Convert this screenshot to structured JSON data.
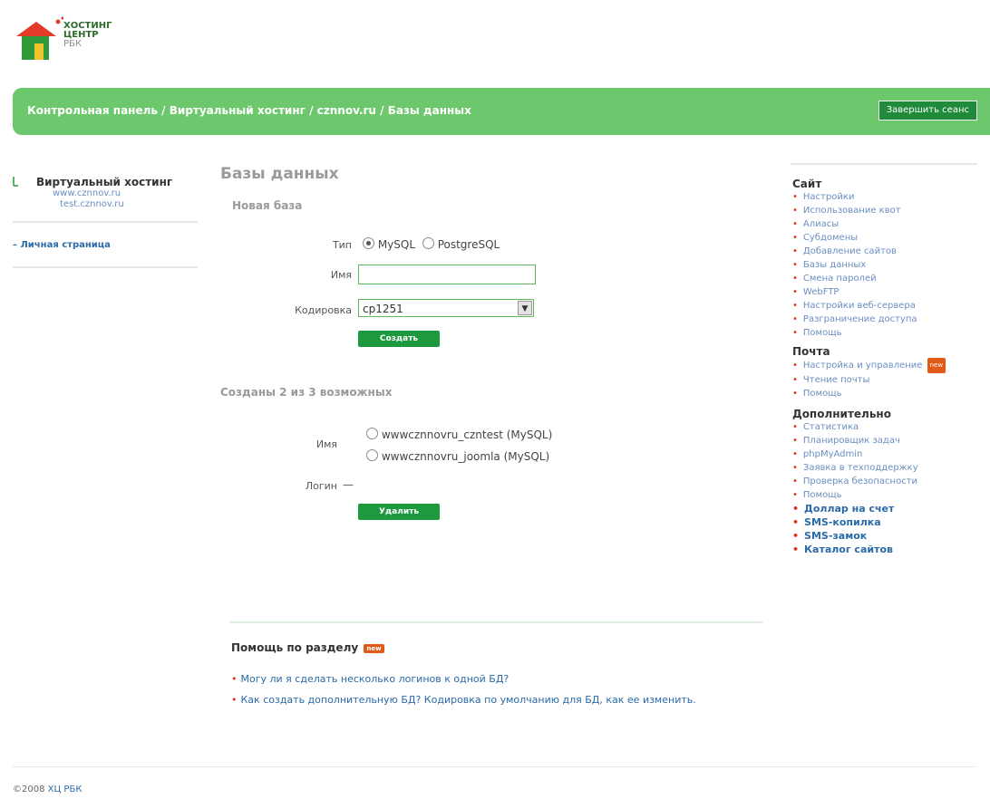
{
  "logo": {
    "line1": "ХОСТИНГ",
    "line2": "ЦЕНТР",
    "line3": "РБК"
  },
  "header": {
    "breadcrumb": [
      "Контрольная панель",
      "Виртуальный хостинг",
      "cznnov.ru",
      "Базы данных"
    ],
    "separator": " / ",
    "logout_label": "Завершить сеанс"
  },
  "left": {
    "title": "Виртуальный хостинг",
    "sub1": "www.cznnov.ru",
    "sub2": "test.cznnov.ru",
    "personal": "Личная страница"
  },
  "main": {
    "title": "Базы данных",
    "new_db": {
      "section_title": "Новая база",
      "type_label": "Тип",
      "type_options": [
        "MySQL",
        "PostgreSQL"
      ],
      "type_selected": "MySQL",
      "name_label": "Имя",
      "name_value": "",
      "encoding_label": "Кодировка",
      "encoding_value": "cp1251",
      "create_label": "Создать"
    },
    "existing": {
      "section_title": "Созданы 2 из 3 возможных",
      "name_label": "Имя",
      "items": [
        "wwwcznnovru_czntest (MySQL)",
        "wwwcznnovru_joomla (MySQL)"
      ],
      "login_label": "Логин",
      "login_value": "—",
      "delete_label": "Удалить"
    },
    "help": {
      "title": "Помощь по разделу",
      "badge": "new",
      "items": [
        "Могу ли я сделать несколько логинов к одной БД?",
        "Как создать дополнительную БД? Кодировка по умолчанию для БД, как ее изменить."
      ]
    }
  },
  "right": {
    "site": {
      "title": "Сайт",
      "items": [
        "Настройки",
        "Использование квот",
        "Алиасы",
        "Субдомены",
        "Добавление сайтов",
        "Базы данных",
        "Смена паролей",
        "WebFTP",
        "Настройки веб-сервера",
        "Разграничение доступа",
        "Помощь"
      ]
    },
    "mail": {
      "title": "Почта",
      "items": [
        "Настройка и управление",
        "Чтение почты",
        "Помощь"
      ],
      "badge": "new"
    },
    "extra": {
      "title": "Дополнительно",
      "items": [
        "Статистика",
        "Планировщик задач",
        "phpMyAdmin",
        "Заявка в техподдержку",
        "Проверка безопасности",
        "Помощь"
      ],
      "bold_items": [
        "Доллар на счет",
        "SMS-копилка",
        "SMS-замок",
        "Каталог сайтов"
      ]
    }
  },
  "footer": {
    "copyright": "©2008",
    "link": "ХЦ РБК"
  },
  "colors": {
    "header_green": "#6dc86d",
    "button_green": "#1e9a3e",
    "badge_orange": "#e05a18",
    "link_blue": "#2a6aa8"
  }
}
